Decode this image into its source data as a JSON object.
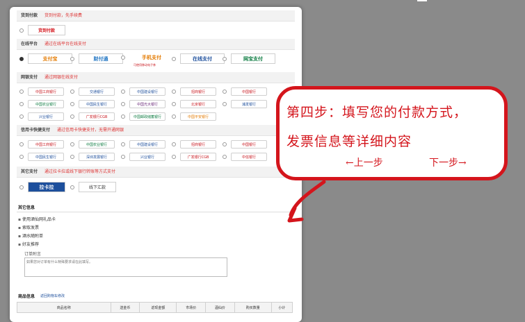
{
  "sections": {
    "cod": {
      "title": "货到付款",
      "note": "货到付款，先手续费",
      "option": "货到付款"
    },
    "online": {
      "title": "在线平台",
      "note": "通过在线平台在线支付",
      "options": [
        "支付宝",
        "财付通",
        "手机支付",
        "在线支付",
        "网宝支付"
      ],
      "mobile_note": "可使用移动电子券"
    },
    "netbank": {
      "title": "网银支付",
      "note": "通过网银在线支付",
      "banks": [
        [
          "中国工商银行",
          "交通银行",
          "中国建设银行",
          "招商银行",
          "中国银行"
        ],
        [
          "中国农业银行",
          "中国民生银行",
          "中国光大银行",
          "北京银行",
          "浦发银行"
        ],
        [
          "兴业银行",
          "广发银行CGB",
          "中国邮政储蓄银行",
          "中国平安银行"
        ]
      ]
    },
    "credit": {
      "title": "信用卡快捷支付",
      "note": "通过信用卡快捷支付，无需开通网银",
      "banks": [
        [
          "中国工商银行",
          "中国农业银行",
          "中国建设银行",
          "招商银行",
          "中国银行"
        ],
        [
          "中国民生银行",
          "深圳发展银行",
          "兴业银行",
          "广发银行CGB",
          "中信银行"
        ]
      ]
    },
    "other": {
      "title": "其它支付",
      "note": "通过拉卡拉或线下银行转账等方式支付",
      "options": [
        "拉卡拉",
        "线下汇款"
      ]
    }
  },
  "other_info": {
    "title": "其它信息",
    "items": [
      "使用酒仙网礼品卡",
      "索取发票",
      "酒水随附单",
      "好友推荐"
    ],
    "order_note_label": "订单附言",
    "order_note_placeholder": "如果您对订单有什么特殊要求请在此填写。"
  },
  "goods": {
    "title": "商品信息",
    "link": "返回购物车修改",
    "columns": [
      "商品名称",
      "送金币",
      "返现金额",
      "市场价",
      "酒仙价",
      "购买数量",
      "小计"
    ]
  },
  "callout": {
    "line1": "第四步：填写您的付款方式，",
    "line2": "发票信息等详细内容",
    "prev": "←上一步",
    "next": "下一步→"
  }
}
